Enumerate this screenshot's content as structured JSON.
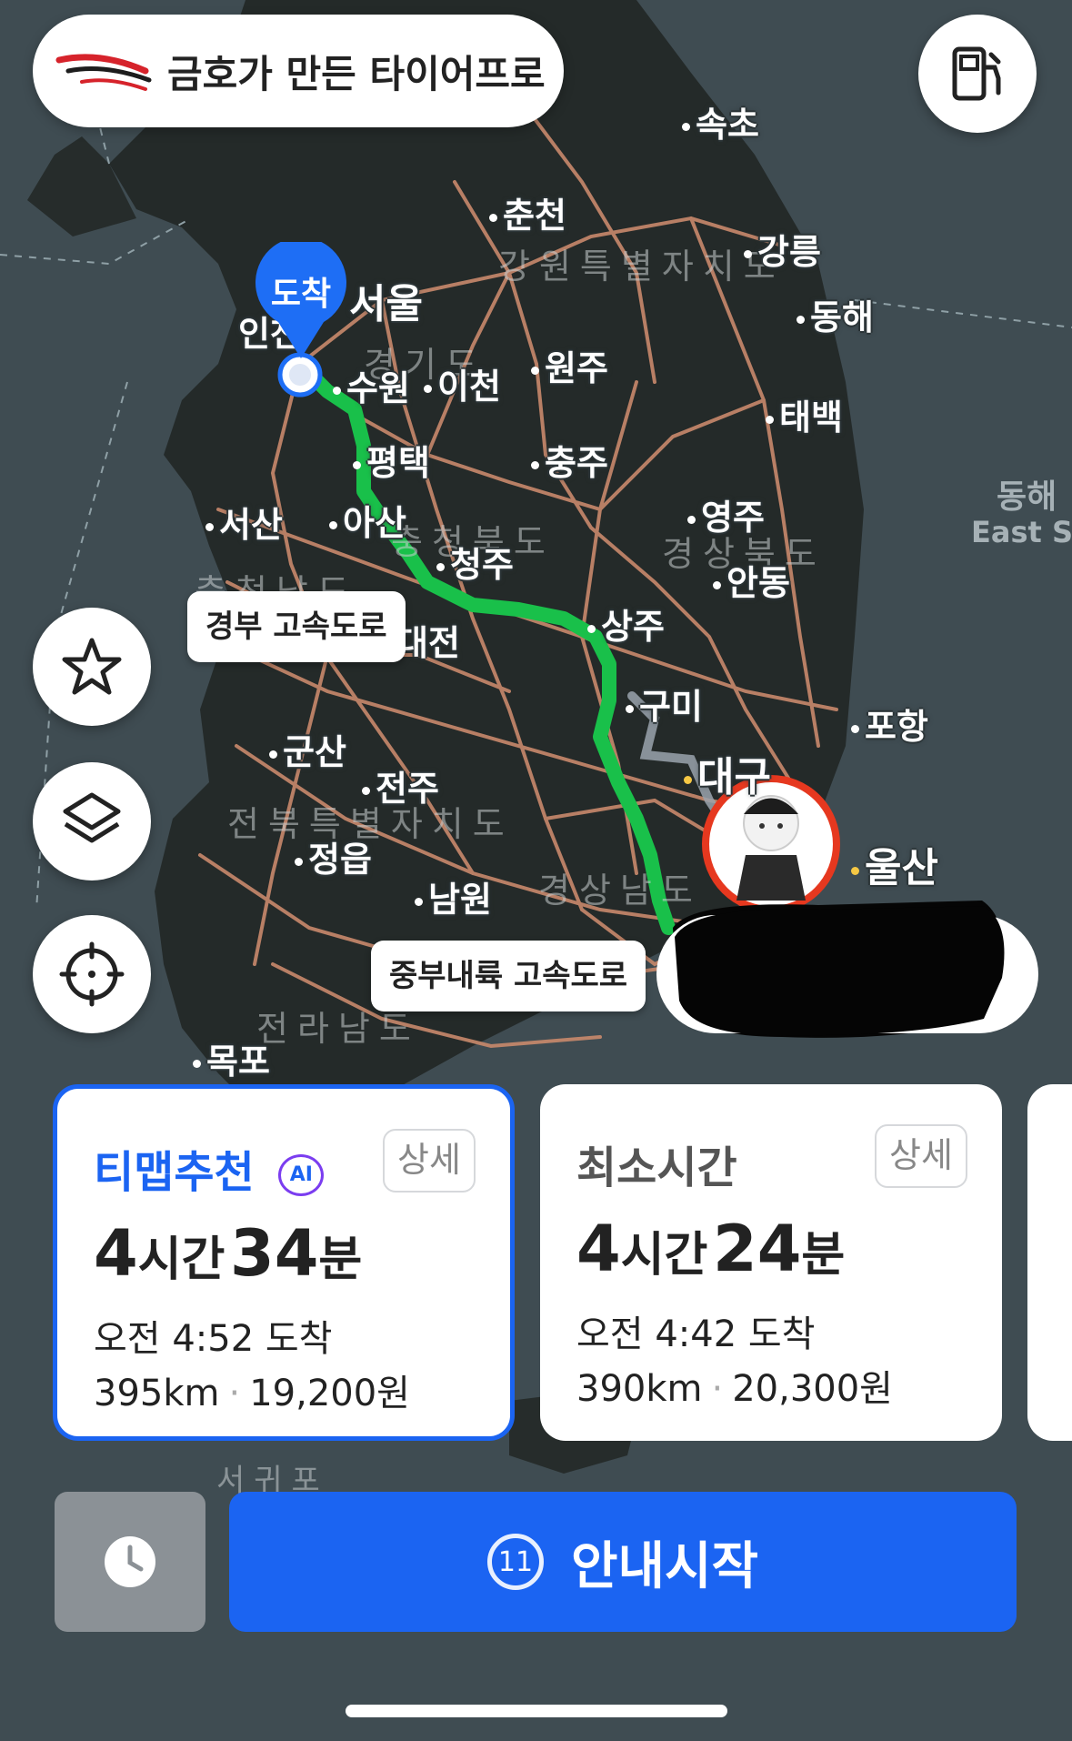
{
  "brand": {
    "banner_text": "금호가 만든 타이어프로"
  },
  "map": {
    "cities": [
      "속초",
      "춘천",
      "강릉",
      "동해",
      "서울",
      "인천",
      "수원",
      "이천",
      "원주",
      "태백",
      "평택",
      "충주",
      "서산",
      "아산",
      "청주",
      "영주",
      "안동",
      "상주",
      "대전",
      "구미",
      "포항",
      "군산",
      "전주",
      "대구",
      "울산",
      "정읍",
      "남원",
      "목포"
    ],
    "regions": [
      "강원특별자치도",
      "경기도",
      "충청북도",
      "경상북도",
      "충청남도",
      "전북특별자치도",
      "경상남도",
      "전라남도"
    ],
    "sea_label_ko": "동해",
    "sea_label_en": "East Se",
    "island_label": "서귀포",
    "destination_label": "도착",
    "road_labels": [
      "경부 고속도로",
      "중부내륙 고속도로"
    ],
    "route_color": "#19c04a"
  },
  "routes": [
    {
      "title": "티맵추천",
      "badge": "AI",
      "detail": "상세",
      "hours": "4",
      "hour_unit": "시간",
      "minutes": "34",
      "minute_unit": "분",
      "arrival": "오전 4:52 도착",
      "distance": "395km",
      "toll": "19,200원",
      "selected": true
    },
    {
      "title": "최소시간",
      "detail": "상세",
      "hours": "4",
      "hour_unit": "시간",
      "minutes": "24",
      "minute_unit": "분",
      "arrival": "오전 4:42 도착",
      "distance": "390km",
      "toll": "20,300원",
      "selected": false
    }
  ],
  "action": {
    "countdown": "11",
    "start_label": "안내시작"
  },
  "icons": [
    "fuel-icon",
    "star-icon",
    "layers-icon",
    "crosshair-icon",
    "clock-icon"
  ]
}
